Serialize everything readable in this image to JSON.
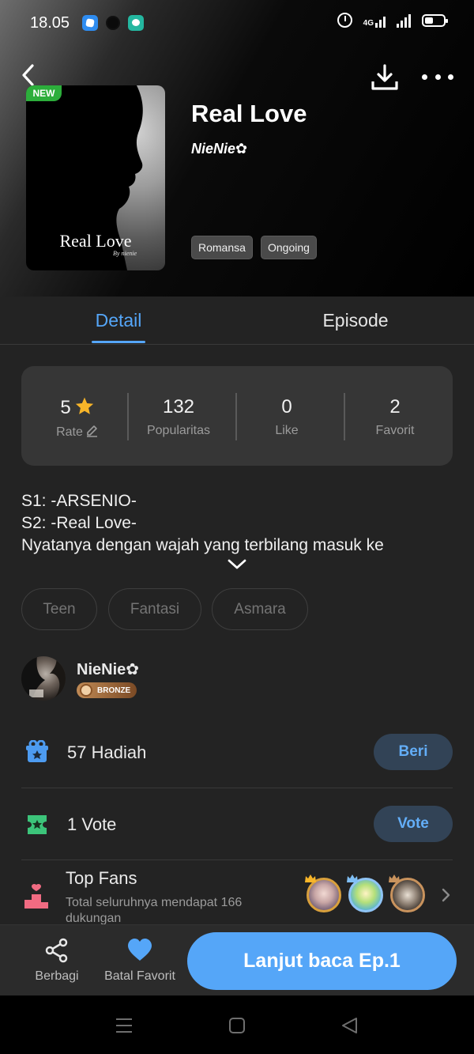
{
  "status_bar": {
    "time": "18.05",
    "network_label": "4G"
  },
  "book": {
    "badge": "NEW",
    "cover_title": "Real Love",
    "cover_byline": "By nienie",
    "title": "Real Love",
    "author": "NieNie✿",
    "genres": [
      "Romansa",
      "Ongoing"
    ]
  },
  "tabs": [
    {
      "label": "Detail",
      "active": true
    },
    {
      "label": "Episode",
      "active": false
    }
  ],
  "stats": {
    "rate": {
      "value": "5",
      "label": "Rate"
    },
    "popularity": {
      "value": "132",
      "label": "Popularitas"
    },
    "like": {
      "value": "0",
      "label": "Like"
    },
    "favorite": {
      "value": "2",
      "label": "Favorit"
    }
  },
  "synopsis": {
    "lines": [
      "S1: -ARSENIO-",
      "S2: -Real Love-",
      "Nyatanya dengan wajah yang terbilang masuk ke"
    ]
  },
  "tags": [
    "Teen",
    "Fantasi",
    "Asmara"
  ],
  "author_card": {
    "name": "NieNie✿",
    "rank": "BRONZE"
  },
  "gifts": {
    "count": "57",
    "label": "Hadiah",
    "button": "Beri"
  },
  "votes": {
    "count": "1",
    "label": "Vote",
    "button": "Vote"
  },
  "top_fans": {
    "title": "Top Fans",
    "subtitle": "Total seluruhnya mendapat 166 dukungan"
  },
  "bottom_bar": {
    "share_label": "Berbagi",
    "favorite_label": "Batal Favorit",
    "read_button": "Lanjut baca Ep.1"
  },
  "colors": {
    "accent": "#55a6f8",
    "new_badge": "#2cae3b",
    "background": "#232323",
    "pill_bg": "#324356",
    "gift_icon": "#4d9bf0",
    "vote_icon": "#3cc47a",
    "fans_icon": "#f06b82"
  }
}
